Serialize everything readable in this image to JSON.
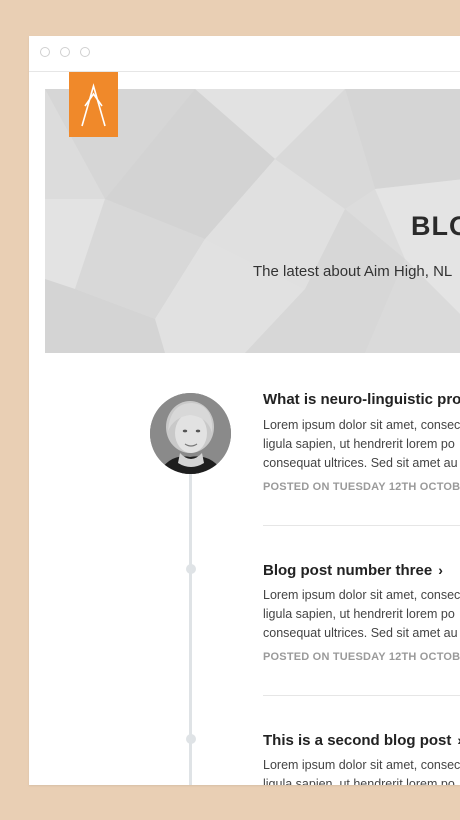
{
  "hero": {
    "title": "BLO",
    "subtitle": "The latest about Aim High, NL"
  },
  "posts": [
    {
      "title": "What is neuro-linguistic pro",
      "chevron": "",
      "lines": [
        "Lorem ipsum dolor sit amet, consec",
        "ligula sapien, ut hendrerit lorem po",
        "consequat ultrices. Sed sit amet au"
      ],
      "meta": "POSTED ON TUESDAY 12TH OCTOBER"
    },
    {
      "title": "Blog post number three",
      "chevron": "›",
      "lines": [
        "Lorem ipsum dolor sit amet, consec",
        "ligula sapien, ut hendrerit lorem po",
        "consequat ultrices. Sed sit amet au"
      ],
      "meta": "POSTED ON TUESDAY 12TH OCTOBER"
    },
    {
      "title": "This is a second blog post",
      "chevron": "›",
      "lines": [
        "Lorem ipsum dolor sit amet, consec",
        "ligula sapien, ut hendrerit lorem po"
      ],
      "meta": ""
    }
  ],
  "colors": {
    "page_background": "#e9cfb4",
    "logo_orange": "#f0892a",
    "hero_gray": "#dcdcdc",
    "timeline": "#dfe3e6"
  },
  "icons": [
    "window-close-dot-icon",
    "window-minimize-dot-icon",
    "window-maximize-dot-icon",
    "chevron-right-icon",
    "aim-high-logo-icon"
  ]
}
